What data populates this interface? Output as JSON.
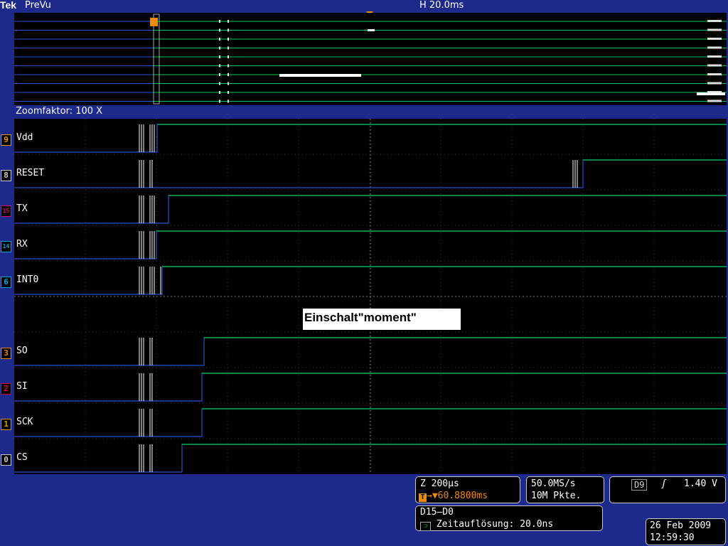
{
  "header": {
    "brand": "Tek",
    "mode": "PreVu",
    "horizontal": "H 20.0ms"
  },
  "zoom": {
    "label": "Zoomfaktor: 100 X"
  },
  "channels": [
    {
      "num": "9",
      "name": "Vdd",
      "color": "#e09a00"
    },
    {
      "num": "8",
      "name": "RESET",
      "color": "#c8c8c8"
    },
    {
      "num": "15",
      "name": "TX",
      "color": "#e0006a"
    },
    {
      "num": "14",
      "name": "RX",
      "color": "#00a8d8"
    },
    {
      "num": "6",
      "name": "INT0",
      "color": "#00a8d8"
    },
    {
      "num": "3",
      "name": "SO",
      "color": "#f08a00"
    },
    {
      "num": "2",
      "name": "SI",
      "color": "#e0002a"
    },
    {
      "num": "1",
      "name": "SCK",
      "color": "#c89a00"
    },
    {
      "num": "0",
      "name": "CS",
      "color": "#c8c8c8"
    }
  ],
  "annotation": "Einschalt\"moment\"",
  "zoom_info": {
    "line1": "Z 200µs",
    "trigger_pos": "60.8800ms"
  },
  "acq": {
    "rate": "50.0MS/s",
    "record": "10M Pkte."
  },
  "trigger": {
    "source": "D9",
    "level": "1.40 V"
  },
  "bus": {
    "name": "D15–D0",
    "resolution": "Zeitauflösung: 20.0ns"
  },
  "datetime": {
    "date": "26 Feb 2009",
    "time": "12:59:30"
  },
  "colors": {
    "background": "#1d2a8c",
    "trace_high": "#00c850",
    "trace_low": "#2850d0",
    "accent": "#f08a00"
  }
}
